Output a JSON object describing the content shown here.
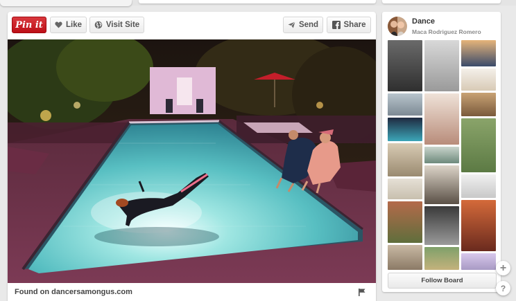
{
  "toolbar": {
    "pinit_label": "Pin it",
    "like_label": "Like",
    "visit_label": "Visit Site",
    "send_label": "Send",
    "share_label": "Share"
  },
  "footer": {
    "found_text": "Found on dancersamongus.com"
  },
  "board": {
    "title": "Dance",
    "owner": "Maca Rodriguez Romero",
    "follow_label": "Follow Board"
  },
  "icons": {
    "like": "heart-icon",
    "visit": "globe-icon",
    "send": "paper-plane-icon",
    "share": "facebook-icon",
    "flag": "flag-icon",
    "add": "plus-icon",
    "help": "question-icon"
  },
  "fab": {
    "add_glyph": "+",
    "help_glyph": "?"
  },
  "colors": {
    "pinit_red": "#cb2027",
    "page_bg": "#e9e9e9",
    "pool_water": "#6fd1cf"
  }
}
